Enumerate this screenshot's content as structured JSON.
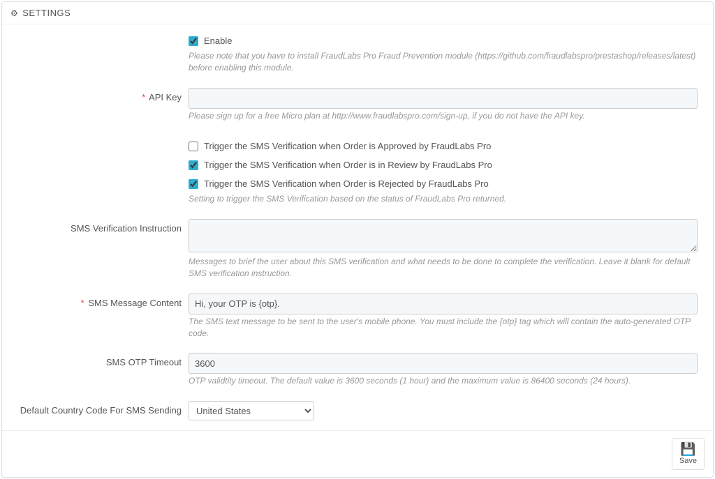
{
  "panel": {
    "title": "SETTINGS"
  },
  "fields": {
    "enable": {
      "label": "Enable",
      "checked": true,
      "help": "Please note that you have to install FraudLabs Pro Fraud Prevention module (https://github.com/fraudlabspro/prestashop/releases/latest) before enabling this module."
    },
    "api_key": {
      "label": "API Key",
      "required": true,
      "value": "",
      "help": "Please sign up for a free Micro plan at http://www.fraudlabspro.com/sign-up, if you do not have the API key."
    },
    "trigger_approved": {
      "label": "Trigger the SMS Verification when Order is Approved by FraudLabs Pro",
      "checked": false
    },
    "trigger_review": {
      "label": "Trigger the SMS Verification when Order is in Review by FraudLabs Pro",
      "checked": true
    },
    "trigger_rejected": {
      "label": "Trigger the SMS Verification when Order is Rejected by FraudLabs Pro",
      "checked": true,
      "help": "Setting to trigger the SMS Verification based on the status of FraudLabs Pro returned."
    },
    "instruction": {
      "label": "SMS Verification Instruction",
      "value": "",
      "help": "Messages to brief the user about this SMS verification and what needs to be done to complete the verification. Leave it blank for default SMS verification instruction."
    },
    "message_content": {
      "label": "SMS Message Content",
      "required": true,
      "value": "Hi, your OTP is {otp}.",
      "help": "The SMS text message to be sent to the user's mobile phone. You must include the {otp} tag which will contain the auto-generated OTP code."
    },
    "otp_timeout": {
      "label": "SMS OTP Timeout",
      "value": "3600",
      "help": "OTP validtity timeout. The default value is 3600 seconds (1 hour) and the maximum value is 86400 seconds (24 hours)."
    },
    "country_code": {
      "label": "Default Country Code For SMS Sending",
      "selected": "United States"
    }
  },
  "footer": {
    "save_label": "Save"
  }
}
